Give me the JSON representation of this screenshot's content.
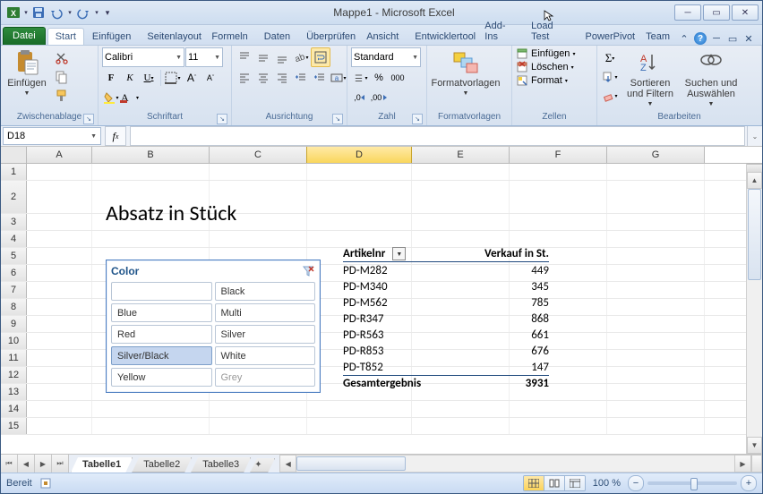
{
  "window": {
    "title": "Mappe1 - Microsoft Excel",
    "min": "_",
    "max": "❐",
    "close": "✕"
  },
  "qat": {
    "save": "save",
    "undo": "undo",
    "redo": "redo"
  },
  "tabs": {
    "file": "Datei",
    "items": [
      "Start",
      "Einfügen",
      "Seitenlayout",
      "Formeln",
      "Daten",
      "Überprüfen",
      "Ansicht",
      "Entwicklertools",
      "Add-Ins",
      "Load Test",
      "PowerPivot",
      "Team"
    ],
    "active": "Start"
  },
  "ribbon": {
    "clipboard": {
      "paste": "Einfügen",
      "group": "Zwischenablage"
    },
    "font": {
      "name": "Calibri",
      "size": "11",
      "group": "Schriftart"
    },
    "align": {
      "group": "Ausrichtung"
    },
    "number": {
      "format": "Standard",
      "group": "Zahl"
    },
    "styles": {
      "btn": "Formatvorlagen",
      "group": "Formatvorlagen"
    },
    "cells": {
      "insert": "Einfügen",
      "delete": "Löschen",
      "format": "Format",
      "group": "Zellen"
    },
    "editing": {
      "sort": "Sortieren und Filtern",
      "find": "Suchen und Auswählen",
      "group": "Bearbeiten"
    }
  },
  "namebox": "D18",
  "columns": [
    "A",
    "B",
    "C",
    "D",
    "E",
    "F",
    "G"
  ],
  "selected_col": "D",
  "rows": [
    1,
    2,
    3,
    4,
    5,
    6,
    7,
    8,
    9,
    10,
    11,
    12,
    13,
    14,
    15
  ],
  "sheet": {
    "title": "Absatz in Stück"
  },
  "slicer": {
    "title": "Color",
    "items": [
      {
        "label": "",
        "selected": false,
        "nodata": false
      },
      {
        "label": "Black",
        "selected": false,
        "nodata": false
      },
      {
        "label": "Blue",
        "selected": false,
        "nodata": false
      },
      {
        "label": "Multi",
        "selected": false,
        "nodata": false
      },
      {
        "label": "Red",
        "selected": false,
        "nodata": false
      },
      {
        "label": "Silver",
        "selected": false,
        "nodata": false
      },
      {
        "label": "Silver/Black",
        "selected": true,
        "nodata": false
      },
      {
        "label": "White",
        "selected": false,
        "nodata": false
      },
      {
        "label": "Yellow",
        "selected": false,
        "nodata": false
      },
      {
        "label": "Grey",
        "selected": false,
        "nodata": true
      }
    ]
  },
  "pivot": {
    "col1": "Artikelnr",
    "col2": "Verkauf in St.",
    "rows": [
      {
        "a": "PD-M282",
        "v": "449"
      },
      {
        "a": "PD-M340",
        "v": "345"
      },
      {
        "a": "PD-M562",
        "v": "785"
      },
      {
        "a": "PD-R347",
        "v": "868"
      },
      {
        "a": "PD-R563",
        "v": "661"
      },
      {
        "a": "PD-R853",
        "v": "676"
      },
      {
        "a": "PD-T852",
        "v": "147"
      }
    ],
    "total_label": "Gesamtergebnis",
    "total_value": "3931"
  },
  "sheets": {
    "active": "Tabelle1",
    "items": [
      "Tabelle1",
      "Tabelle2",
      "Tabelle3"
    ]
  },
  "status": {
    "ready": "Bereit",
    "zoom": "100 %"
  }
}
